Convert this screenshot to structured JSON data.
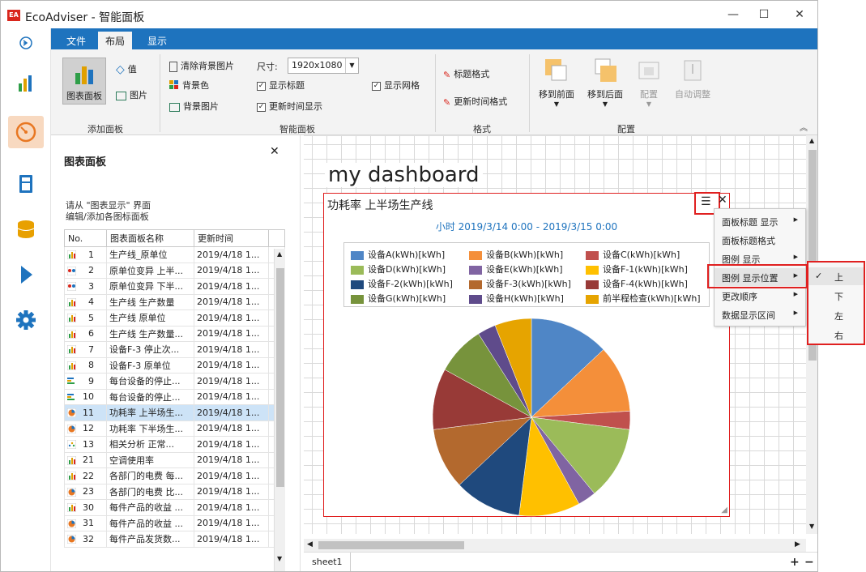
{
  "window": {
    "title": "EcoAdviser - 智能面板",
    "app_icon_text": "EA"
  },
  "ribbon": {
    "tabs": [
      "文件",
      "布局",
      "显示"
    ],
    "add_panel": {
      "chart_panel": "图表面板",
      "value": "值",
      "image": "图片",
      "label": "添加面板"
    },
    "smart_panel": {
      "clear_bg_image": "清除背景图片",
      "size_label": "尺寸:",
      "size_value": "1920x1080",
      "bg_color": "背景色",
      "show_title": "显示标题",
      "show_grid": "显示网格",
      "bg_image": "背景图片",
      "update_time_show": "更新时间显示",
      "label": "智能面板"
    },
    "format": {
      "title_format": "标题格式",
      "update_time_format": "更新时间格式",
      "label": "格式"
    },
    "arrange": {
      "bring_front": "移到前面",
      "send_back": "移到后面",
      "layout": "配置",
      "auto_adjust": "自动调整",
      "label": "配置"
    }
  },
  "panel": {
    "title": "图表面板",
    "hint_line1": "请从 \"图表显示\" 界面",
    "hint_line2": "编辑/添加各图标面板",
    "columns": [
      "No.",
      "图表面板名称",
      "更新时间"
    ],
    "rows": [
      {
        "icon": "bar",
        "no": "1",
        "name": "生产线_原单位",
        "time": "2019/4/18 1..."
      },
      {
        "icon": "gauge",
        "no": "2",
        "name": "原单位变异 上半...",
        "time": "2019/4/18 1..."
      },
      {
        "icon": "gauge",
        "no": "3",
        "name": "原单位变异 下半...",
        "time": "2019/4/18 1..."
      },
      {
        "icon": "bar",
        "no": "4",
        "name": "生产线 生产数量",
        "time": "2019/4/18 1..."
      },
      {
        "icon": "bar",
        "no": "5",
        "name": "生产线 原单位",
        "time": "2019/4/18 1..."
      },
      {
        "icon": "bar",
        "no": "6",
        "name": "生产线 生产数量...",
        "time": "2019/4/18 1..."
      },
      {
        "icon": "bar",
        "no": "7",
        "name": "设备F-3 停止次...",
        "time": "2019/4/18 1..."
      },
      {
        "icon": "bar",
        "no": "8",
        "name": "设备F-3 原单位",
        "time": "2019/4/18 1..."
      },
      {
        "icon": "hbar",
        "no": "9",
        "name": "每台设备的停止...",
        "time": "2019/4/18 1..."
      },
      {
        "icon": "hbar",
        "no": "10",
        "name": "每台设备的停止...",
        "time": "2019/4/18 1..."
      },
      {
        "icon": "pie",
        "no": "11",
        "name": "功耗率 上半场生...",
        "time": "2019/4/18 1..."
      },
      {
        "icon": "pie",
        "no": "12",
        "name": "功耗率 下半场生...",
        "time": "2019/4/18 1..."
      },
      {
        "icon": "scatter",
        "no": "13",
        "name": "相关分析  正常...",
        "time": "2019/4/18 1..."
      },
      {
        "icon": "bar",
        "no": "21",
        "name": "空调使用率",
        "time": "2019/4/18 1..."
      },
      {
        "icon": "bar",
        "no": "22",
        "name": "各部门的电费 每...",
        "time": "2019/4/18 1..."
      },
      {
        "icon": "pie",
        "no": "23",
        "name": "各部门的电费 比...",
        "time": "2019/4/18 1..."
      },
      {
        "icon": "bar",
        "no": "30",
        "name": "每件产品的收益 ...",
        "time": "2019/4/18 1..."
      },
      {
        "icon": "pie",
        "no": "31",
        "name": "每件产品的收益 ...",
        "time": "2019/4/18 1..."
      },
      {
        "icon": "pie",
        "no": "32",
        "name": "每件产品发货数...",
        "time": "2019/4/18 1..."
      }
    ],
    "selected_row": 10
  },
  "dashboard": {
    "title": "my dashboard",
    "panel_title": "功耗率 上半场生产线",
    "subtitle": "小时 2019/3/14 0:00 - 2019/3/15 0:00",
    "sheet": "sheet1"
  },
  "chart_data": {
    "type": "pie",
    "title": "功耗率 上半场生产线",
    "subtitle": "小时 2019/3/14 0:00 - 2019/3/15 0:00",
    "legend_position": "top",
    "series": [
      {
        "name": "设备A(kWh)[kWh]",
        "color": "#4f86c6",
        "value": 13.0
      },
      {
        "name": "设备B(kWh)[kWh]",
        "color": "#f48f3a",
        "value": 11.0
      },
      {
        "name": "设备C(kWh)[kWh]",
        "color": "#c0504d",
        "value": 3.0
      },
      {
        "name": "设备D(kWh)[kWh]",
        "color": "#9bbb59",
        "value": 12.0
      },
      {
        "name": "设备E(kWh)[kWh]",
        "color": "#8064a2",
        "value": 3.0
      },
      {
        "name": "设备F-1(kWh)[kWh]",
        "color": "#ffc000",
        "value": 10.0
      },
      {
        "name": "设备F-2(kWh)[kWh]",
        "color": "#1f497d",
        "value": 11.0
      },
      {
        "name": "设备F-3(kWh)[kWh]",
        "color": "#b3692e",
        "value": 10.0
      },
      {
        "name": "设备F-4(kWh)[kWh]",
        "color": "#983a37",
        "value": 10.0
      },
      {
        "name": "设备G(kWh)[kWh]",
        "color": "#77933c",
        "value": 8.0
      },
      {
        "name": "设备H(kWh)[kWh]",
        "color": "#5f4b8b",
        "value": 3.0
      },
      {
        "name": "前半程检查(kWh)[kWh]",
        "color": "#e6a400",
        "value": 6.0
      }
    ]
  },
  "context_menu": {
    "items": [
      {
        "label": "面板标题 显示",
        "submenu": true
      },
      {
        "label": "面板标题格式",
        "submenu": false
      },
      {
        "label": "图例 显示",
        "submenu": true
      },
      {
        "label": "图例 显示位置",
        "submenu": true
      },
      {
        "label": "更改顺序",
        "submenu": true
      },
      {
        "label": "数据显示区间",
        "submenu": true
      }
    ],
    "active_index": 3,
    "submenu_items": [
      "上",
      "下",
      "左",
      "右"
    ],
    "submenu_checked": 0
  },
  "colors": {
    "accent": "#1e73be",
    "highlight": "#e02020",
    "nav_active_bg": "#f8d9c0"
  }
}
